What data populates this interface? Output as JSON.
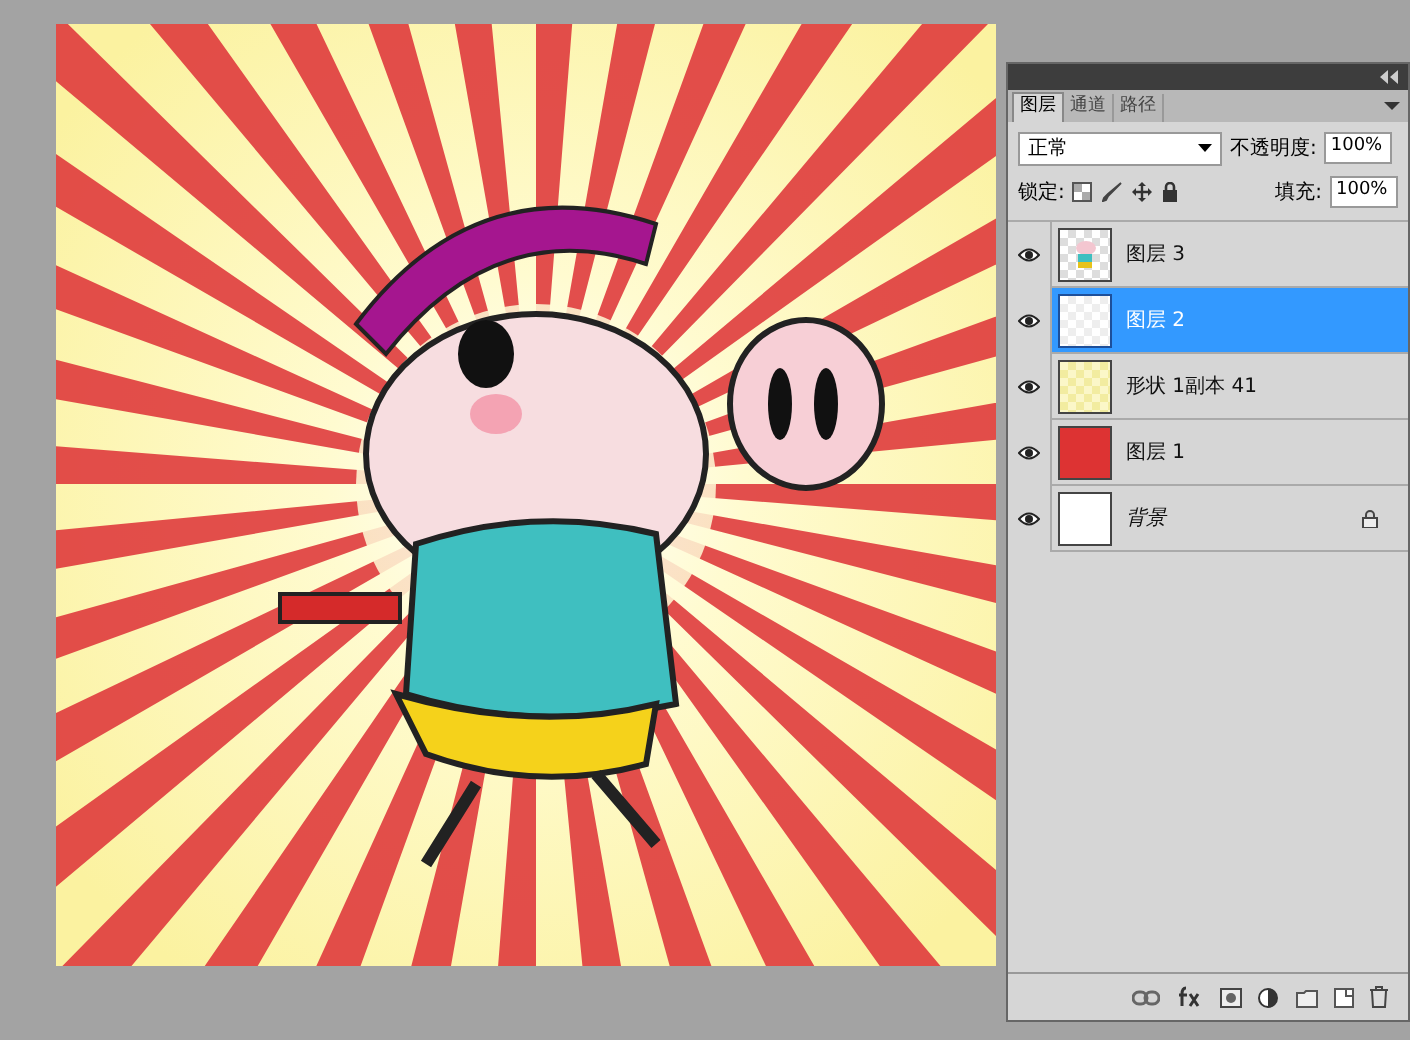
{
  "panel": {
    "tabs": [
      {
        "label": "图层",
        "selected": true
      },
      {
        "label": "通道",
        "selected": false
      },
      {
        "label": "路径",
        "selected": false
      }
    ],
    "blend_mode": "正常",
    "opacity_label": "不透明度:",
    "opacity": "100%",
    "lock_label": "锁定:",
    "fill_label": "填充:",
    "fill": "100%",
    "layers": [
      {
        "name": "图层 3",
        "visible": true,
        "selected": false,
        "locked": false,
        "kind": "artwork"
      },
      {
        "name": "图层 2",
        "visible": true,
        "selected": true,
        "locked": false,
        "kind": "transparent"
      },
      {
        "name": "形状 1副本 41",
        "visible": true,
        "selected": false,
        "locked": false,
        "kind": "pattern"
      },
      {
        "name": "图层 1",
        "visible": true,
        "selected": false,
        "locked": false,
        "kind": "solid"
      },
      {
        "name": "背景",
        "visible": true,
        "selected": false,
        "locked": true,
        "kind": "background"
      }
    ]
  }
}
